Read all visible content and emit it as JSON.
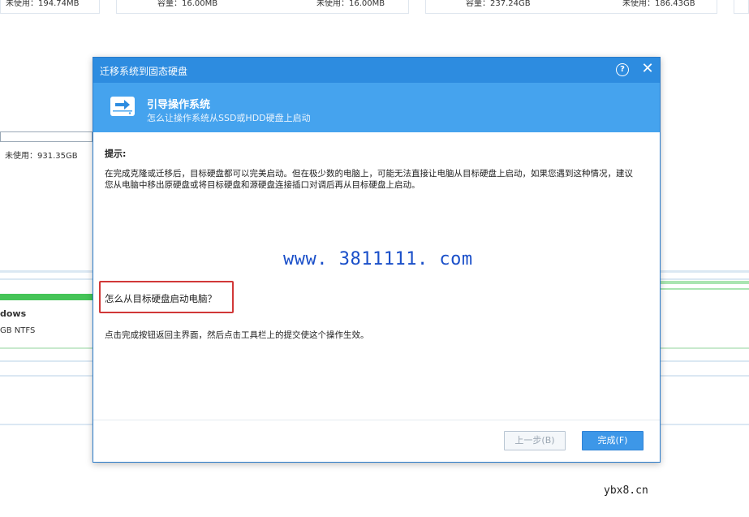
{
  "background": {
    "card1": {
      "unused": "未使用：194.74MB"
    },
    "card2": {
      "capacity": "容量：16.00MB",
      "unused": "未使用：16.00MB"
    },
    "card3": {
      "capacity": "容量：237.24GB",
      "unused": "未使用：186.43GB"
    },
    "disk_unused": "未使用：931.35GB",
    "partition_name": "dows",
    "partition_info": "GB NTFS"
  },
  "dialog": {
    "title": "迁移系统到固态硬盘",
    "help_glyph": "?",
    "close_glyph": "✕",
    "header_title": "引导操作系统",
    "header_subtitle": "怎么让操作系统从SSD或HDD硬盘上启动",
    "tip_label": "提示:",
    "tip_text": "在完成克隆或迁移后，目标硬盘都可以完美启动。但在极少数的电脑上，可能无法直接让电脑从目标硬盘上启动，如果您遇到这种情况，建议您从电脑中移出原硬盘或将目标硬盘和源硬盘连接插口对调后再从目标硬盘上启动。",
    "question": "怎么从目标硬盘启动电脑？",
    "instruction": "点击完成按钮返回主界面，然后点击工具栏上的提交使这个操作生效。",
    "buttons": {
      "prev": "上一步(B)",
      "finish": "完成(F)"
    }
  },
  "watermark": "www. 3811111. com",
  "site_mark": "ybx8.cn",
  "colors": {
    "title_bar": "#2d8ce0",
    "header": "#45a3ee",
    "highlight_box": "#d13838",
    "watermark": "#1a4fc9"
  },
  "icons": {
    "help": "help-icon",
    "close": "close-icon",
    "drive": "drive-icon"
  }
}
